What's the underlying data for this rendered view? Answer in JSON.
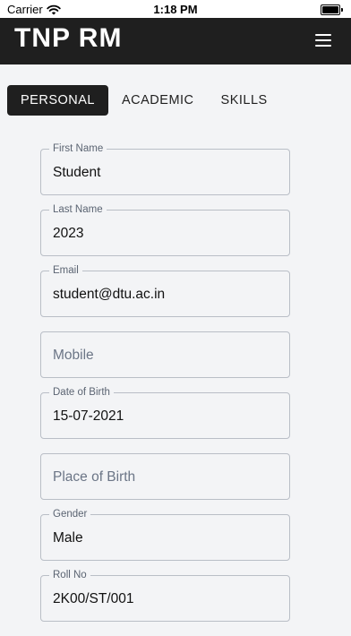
{
  "status_bar": {
    "carrier": "Carrier",
    "time": "1:18 PM",
    "battery_level": 1.0
  },
  "header": {
    "title": "TNP RM"
  },
  "tabs": [
    {
      "label": "PERSONAL",
      "active": true
    },
    {
      "label": "ACADEMIC",
      "active": false
    },
    {
      "label": "SKILLS",
      "active": false
    }
  ],
  "form": {
    "first_name": {
      "label": "First Name",
      "value": "Student"
    },
    "last_name": {
      "label": "Last Name",
      "value": "2023"
    },
    "email": {
      "label": "Email",
      "value": "student@dtu.ac.in"
    },
    "mobile": {
      "placeholder": "Mobile"
    },
    "dob": {
      "label": "Date of Birth",
      "value": "15-07-2021"
    },
    "place_of_birth": {
      "placeholder": "Place of Birth"
    },
    "gender": {
      "label": "Gender",
      "value": "Male"
    },
    "roll_no": {
      "label": "Roll No",
      "value": "2K00/ST/001"
    }
  },
  "colors": {
    "header_bg": "#1f1f1f",
    "page_bg": "#f3f4f6",
    "field_border": "#b9bec6"
  }
}
